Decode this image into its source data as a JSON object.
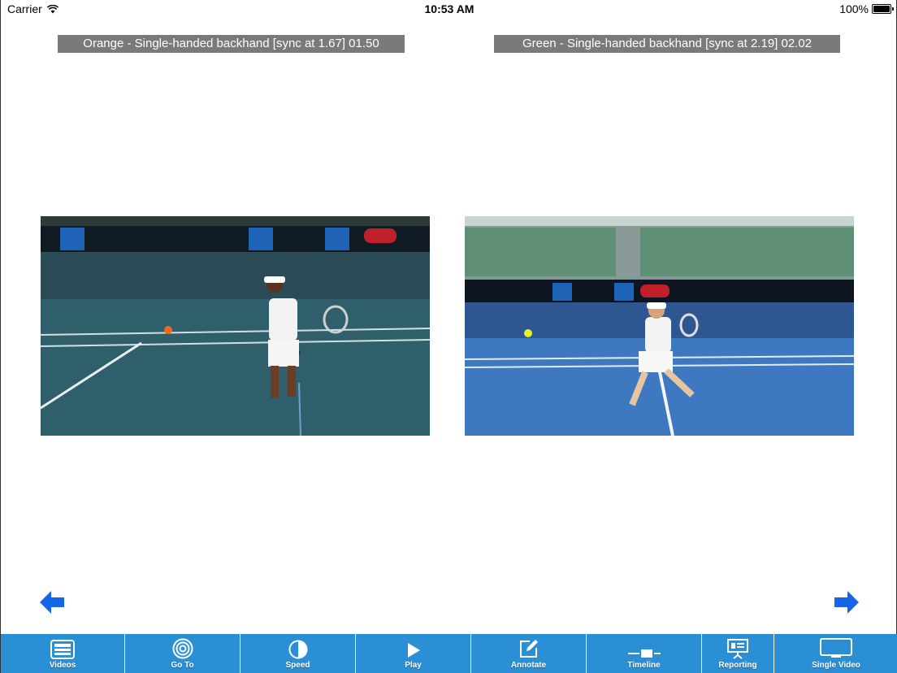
{
  "status_bar": {
    "carrier": "Carrier",
    "time": "10:53 AM",
    "battery": "100%"
  },
  "videos": {
    "left": {
      "title": "Orange - Single-handed backhand [sync at 1.67]  01.50"
    },
    "right": {
      "title": "Green - Single-handed backhand [sync at 2.19]  02.02"
    }
  },
  "nav": {
    "prev_icon": "arrow-left-icon",
    "next_icon": "arrow-right-icon"
  },
  "toolbar": {
    "items": [
      {
        "label": "Videos",
        "icon": "videos-icon"
      },
      {
        "label": "Go To",
        "icon": "target-icon"
      },
      {
        "label": "Speed",
        "icon": "contrast-icon"
      },
      {
        "label": "Play",
        "icon": "play-icon"
      },
      {
        "label": "Annotate",
        "icon": "edit-icon"
      },
      {
        "label": "Timeline",
        "icon": "timeline-icon"
      },
      {
        "label": "Reporting",
        "icon": "presentation-icon"
      },
      {
        "label": "Single Video",
        "icon": "monitor-icon"
      }
    ]
  },
  "colors": {
    "toolbar": "#2b8fd6",
    "title_bar": "#7a7a7a",
    "arrow": "#1565e6"
  }
}
